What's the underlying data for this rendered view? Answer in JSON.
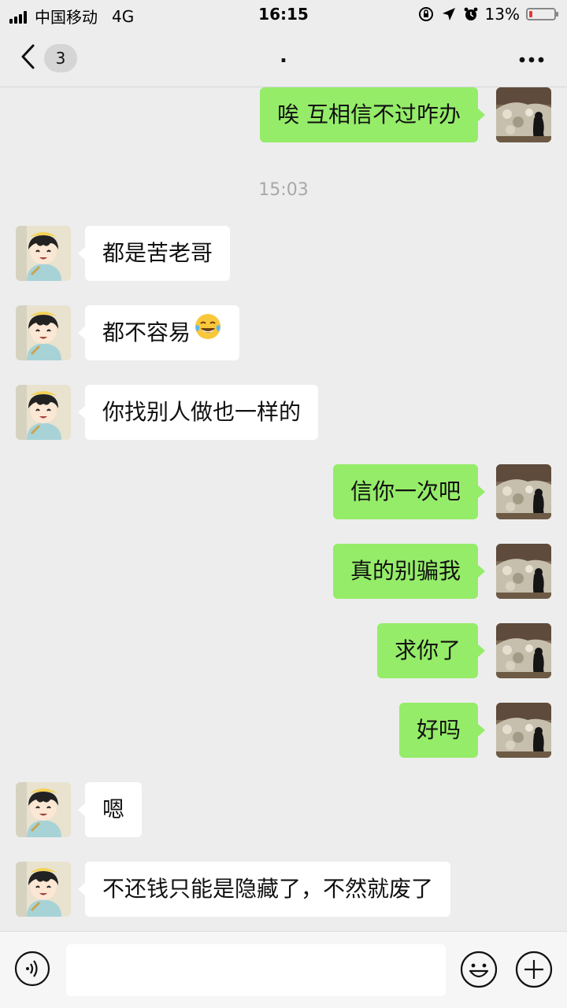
{
  "status_bar": {
    "carrier": "中国移动",
    "network": "4G",
    "time": "16:15",
    "battery_percent": "13%",
    "battery_level": 0.13,
    "battery_color": "#e53935"
  },
  "header": {
    "back_icon": "chevron-left-icon",
    "unread_count": "3",
    "title": ".",
    "more_icon": "more-dots-icon"
  },
  "messages": [
    {
      "side": "out",
      "text": "唉 互相信不过咋办"
    },
    {
      "type": "time",
      "text": "15:03"
    },
    {
      "side": "in",
      "text": "都是苦老哥"
    },
    {
      "side": "in",
      "text": "都不容易",
      "emoji": "tears-of-joy-emoji"
    },
    {
      "side": "in",
      "text": "你找别人做也一样的"
    },
    {
      "side": "out",
      "text": "信你一次吧"
    },
    {
      "side": "out",
      "text": "真的别骗我"
    },
    {
      "side": "out",
      "text": "求你了"
    },
    {
      "side": "out",
      "text": "好吗"
    },
    {
      "side": "in",
      "text": "嗯"
    },
    {
      "side": "in",
      "text": "不还钱只能是隐藏了，不然就废了"
    }
  ],
  "input_bar": {
    "voice_icon": "voice-icon",
    "input_value": "",
    "emoji_icon": "smiley-icon",
    "plus_icon": "plus-circle-icon"
  },
  "colors": {
    "background": "#ededed",
    "outgoing_bubble": "#95ec69",
    "incoming_bubble": "#ffffff"
  }
}
